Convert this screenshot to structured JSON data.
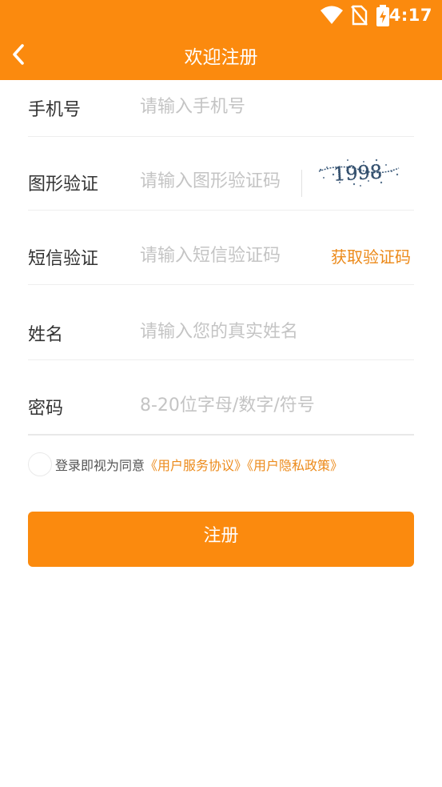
{
  "status_bar": {
    "time": "4:17",
    "icons": [
      "wifi-icon",
      "no-sim-icon",
      "battery-charging-icon"
    ]
  },
  "header": {
    "title": "欢迎注册",
    "back_icon": "chevron-left-icon"
  },
  "form": {
    "phone": {
      "label": "手机号",
      "placeholder": "请输入手机号"
    },
    "captcha": {
      "label": "图形验证",
      "placeholder": "请输入图形验证码",
      "image_text": "1998"
    },
    "sms": {
      "label": "短信验证",
      "placeholder": "请输入短信验证码",
      "button": "获取验证码"
    },
    "name": {
      "label": "姓名",
      "placeholder": "请输入您的真实姓名"
    },
    "password": {
      "label": "密码",
      "placeholder": "8-20位字母/数字/符号"
    }
  },
  "agreement": {
    "prefix": "登录即视为同意",
    "link1": "《用户服务协议》",
    "link2": "《用户隐私政策》"
  },
  "submit_label": "注册",
  "colors": {
    "brand": "#fb8a0e",
    "link": "#ec8a1a",
    "placeholder": "#c4c4c4",
    "label": "#333333"
  }
}
